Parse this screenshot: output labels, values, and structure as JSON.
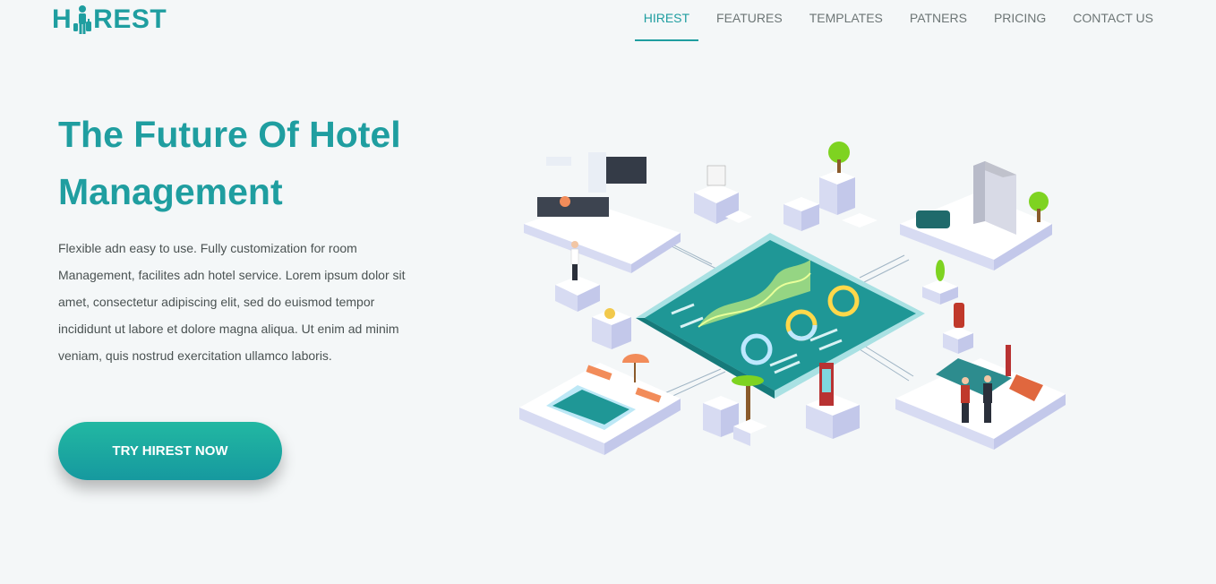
{
  "brand": {
    "name_prefix": "H",
    "name_suffix": "REST",
    "color": "#1f9ea0"
  },
  "nav": {
    "items": [
      {
        "label": "HIREST",
        "active": true
      },
      {
        "label": "FEATURES",
        "active": false
      },
      {
        "label": "TEMPLATES",
        "active": false
      },
      {
        "label": "PATNERS",
        "active": false
      },
      {
        "label": "PRICING",
        "active": false
      },
      {
        "label": "CONTACT US",
        "active": false
      }
    ]
  },
  "hero": {
    "title_line1": "The Future Of Hotel",
    "title_line2": "Management",
    "description": "Flexible adn easy to use. Fully customization for room Management, facilites adn hotel service. Lorem ipsum dolor sit amet, consectetur adipiscing elit, sed do euismod tempor incididunt ut labore et dolore magna aliqua. Ut enim ad minim veniam, quis nostrud exercitation ullamco laboris.",
    "cta_label": "TRY HIREST NOW"
  },
  "colors": {
    "accent": "#1f9ea0",
    "button_top": "#22b8a2",
    "button_bottom": "#16999f",
    "background": "#f4f7f8",
    "body_text": "#4a5252",
    "nav_text": "#6d7676"
  },
  "illustration": {
    "name": "isometric-hotel-dashboard-illustration"
  }
}
